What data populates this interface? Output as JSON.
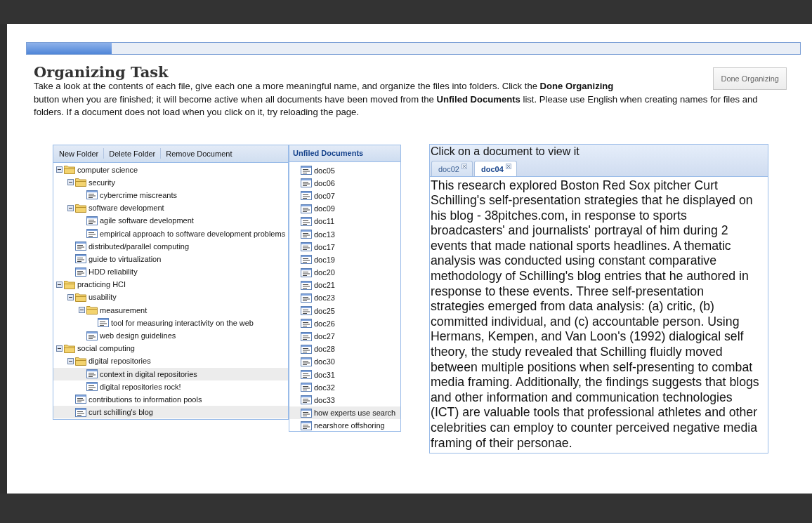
{
  "progress": {
    "level": 0.11
  },
  "title": "Organizing Task",
  "instructions": "Take a look at the contents of each file, give each one a more meaningful name, and organize the files into folders. Click the **Done Organizing** button when you are finished; it will become active when all documents have been moved from the **Unfiled Documents** list. Please use English when creating names for files and folders. If a document does not load when you click on it, try reloading the page.",
  "done_button": {
    "label": "Done Organizing",
    "disabled": true
  },
  "toolbar": [
    "New Folder",
    "Delete Folder",
    "Remove Document"
  ],
  "tree": [
    {
      "kind": "folder",
      "label": "computer science",
      "expanded": true,
      "selected": false,
      "children": [
        {
          "kind": "folder",
          "label": "security",
          "expanded": true,
          "selected": false,
          "children": [
            {
              "kind": "doc",
              "label": "cybercrime miscreants",
              "selected": false
            }
          ]
        },
        {
          "kind": "folder",
          "label": "software development",
          "expanded": true,
          "selected": false,
          "children": [
            {
              "kind": "doc",
              "label": "agile software development",
              "selected": false
            },
            {
              "kind": "doc",
              "label": "empirical approach to software development problems",
              "selected": false
            }
          ]
        },
        {
          "kind": "doc",
          "label": "distributed/parallel computing",
          "selected": false
        },
        {
          "kind": "doc",
          "label": "guide to virtualization",
          "selected": false
        },
        {
          "kind": "doc",
          "label": "HDD reliability",
          "selected": false
        }
      ]
    },
    {
      "kind": "folder",
      "label": "practicing HCI",
      "expanded": true,
      "selected": false,
      "children": [
        {
          "kind": "folder",
          "label": "usability",
          "expanded": true,
          "selected": false,
          "children": [
            {
              "kind": "folder",
              "label": "measurement",
              "expanded": true,
              "selected": false,
              "children": [
                {
                  "kind": "doc",
                  "label": "tool for measuring interactivity on the web",
                  "selected": false
                }
              ]
            },
            {
              "kind": "doc",
              "label": "web design guidelines",
              "selected": false
            }
          ]
        }
      ]
    },
    {
      "kind": "folder",
      "label": "social computing",
      "expanded": true,
      "selected": false,
      "children": [
        {
          "kind": "folder",
          "label": "digital repositories",
          "expanded": true,
          "selected": false,
          "children": [
            {
              "kind": "doc",
              "label": "context in digital repositories",
              "selected": true
            },
            {
              "kind": "doc",
              "label": "digital repositories rock!",
              "selected": false
            }
          ]
        },
        {
          "kind": "doc",
          "label": "contributions to information pools",
          "selected": false
        },
        {
          "kind": "doc",
          "label": "curt schilling's blog",
          "selected": true
        }
      ]
    }
  ],
  "unfiled": {
    "title": "Unfiled Documents",
    "items": [
      {
        "label": "doc05",
        "selected": false
      },
      {
        "label": "doc06",
        "selected": false
      },
      {
        "label": "doc07",
        "selected": false
      },
      {
        "label": "doc09",
        "selected": false
      },
      {
        "label": "doc11",
        "selected": false
      },
      {
        "label": "doc13",
        "selected": false
      },
      {
        "label": "doc17",
        "selected": false
      },
      {
        "label": "doc19",
        "selected": false
      },
      {
        "label": "doc20",
        "selected": false
      },
      {
        "label": "doc21",
        "selected": false
      },
      {
        "label": "doc23",
        "selected": false
      },
      {
        "label": "doc25",
        "selected": false
      },
      {
        "label": "doc26",
        "selected": false
      },
      {
        "label": "doc27",
        "selected": false
      },
      {
        "label": "doc28",
        "selected": false
      },
      {
        "label": "doc30",
        "selected": false
      },
      {
        "label": "doc31",
        "selected": false
      },
      {
        "label": "doc32",
        "selected": false
      },
      {
        "label": "doc33",
        "selected": false
      },
      {
        "label": "how experts use search",
        "selected": true
      },
      {
        "label": "nearshore offshoring",
        "selected": false
      }
    ]
  },
  "viewer": {
    "heading": "Click on a document to view it",
    "tabs": [
      {
        "label": "doc02",
        "selected": false
      },
      {
        "label": "doc04",
        "selected": true
      }
    ],
    "text": "This research explored Boston Red Sox pitcher Curt Schilling's self-presentation strategies that he displayed on his blog - 38pitches.com, in response to sports broadcasters' and journalists' portrayal of him during 2 events that made national sports headlines. A thematic analysis was conducted using constant comparative methodology of Schilling's blog entries that he authored in response to these events. Three self-presentation strategies emerged from data analysis: (a) critic, (b) committed individual, and (c) accountable person. Using Hermans, Kempen, and Van Loon's (1992) dialogical self theory, the study revealed that Schilling fluidly moved between multiple positions when self-presenting to combat media framing. Additionally, the findings suggests that blogs and other information and communication technologies (ICT) are valuable tools that professional athletes and other celebrities can employ to counter perceived negative media framing of their personae."
  }
}
